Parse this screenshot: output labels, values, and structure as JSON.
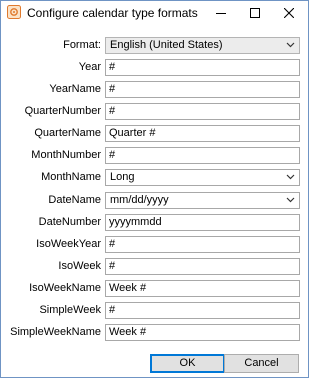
{
  "window": {
    "title": "Configure calendar type formats"
  },
  "form": {
    "format": {
      "label": "Format:",
      "value": "English (United States)"
    },
    "year": {
      "label": "Year",
      "value": "#"
    },
    "year_name": {
      "label": "YearName",
      "value": "#"
    },
    "quarter_number": {
      "label": "QuarterNumber",
      "value": "#"
    },
    "quarter_name": {
      "label": "QuarterName",
      "value": "Quarter #"
    },
    "month_number": {
      "label": "MonthNumber",
      "value": "#"
    },
    "month_name": {
      "label": "MonthName",
      "value": "Long"
    },
    "date_name": {
      "label": "DateName",
      "value": "mm/dd/yyyy"
    },
    "date_number": {
      "label": "DateNumber",
      "value": "yyyymmdd"
    },
    "iso_week_year": {
      "label": "IsoWeekYear",
      "value": "#"
    },
    "iso_week": {
      "label": "IsoWeek",
      "value": "#"
    },
    "iso_week_name": {
      "label": "IsoWeekName",
      "value": "Week #"
    },
    "simple_week": {
      "label": "SimpleWeek",
      "value": "#"
    },
    "simple_week_name": {
      "label": "SimpleWeekName",
      "value": "Week #"
    }
  },
  "buttons": {
    "ok": "OK",
    "cancel": "Cancel"
  },
  "icons": {
    "app": "calendar-settings-icon",
    "minimize": "minimize-icon",
    "maximize": "maximize-icon",
    "close": "close-icon",
    "dropdown": "chevron-down-icon"
  },
  "colors": {
    "default_button_border": "#0078d7",
    "window_border": "#6f94c4"
  }
}
